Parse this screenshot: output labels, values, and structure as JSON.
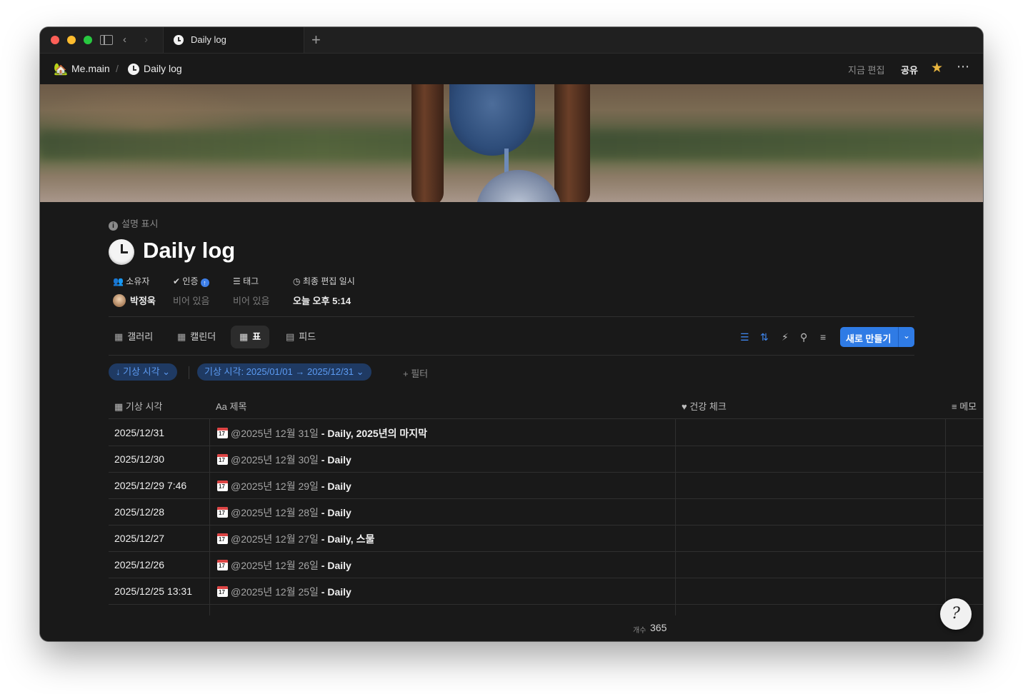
{
  "browser": {
    "tab_title": "Daily log",
    "new_tab_symbol": "+"
  },
  "breadcrumb": {
    "workspace": "Me.main",
    "separator": "/",
    "page": "Daily log"
  },
  "header_actions": {
    "edited": "지금 편집",
    "share": "공유"
  },
  "page": {
    "description_toggle": "설명 표시",
    "title": "Daily log"
  },
  "properties": [
    {
      "label": "소유자",
      "value": "박정욱",
      "empty": false
    },
    {
      "label": "인증",
      "value": "비어 있음",
      "empty": true
    },
    {
      "label": "태그",
      "value": "비어 있음",
      "empty": true
    },
    {
      "label": "최종 편집 일시",
      "value": "오늘 오후 5:14",
      "empty": false
    }
  ],
  "views": [
    {
      "label": "갤러리",
      "icon": "gallery-icon"
    },
    {
      "label": "캘린더",
      "icon": "calendar-icon"
    },
    {
      "label": "표",
      "icon": "table-icon",
      "active": true
    },
    {
      "label": "피드",
      "icon": "feed-icon"
    }
  ],
  "new_button": "새로 만들기",
  "filters": {
    "sort_chip": "↓ 기상 시각 ⌄",
    "range_chip": "기상 시각: 2025/01/01 → 2025/12/31 ⌄",
    "add_filter": "+ 필터"
  },
  "table": {
    "headers": [
      "기상 시각",
      "제목",
      "건강 체크",
      "메모"
    ],
    "rows": [
      {
        "date": "2025/12/31",
        "mention": "@2025년 12월 31일",
        "suffix": " - Daily, 2025년의 마지막"
      },
      {
        "date": "2025/12/30",
        "mention": "@2025년 12월 30일",
        "suffix": " - Daily"
      },
      {
        "date": "2025/12/29 7:46",
        "mention": "@2025년 12월 29일",
        "suffix": " - Daily"
      },
      {
        "date": "2025/12/28",
        "mention": "@2025년 12월 28일",
        "suffix": " - Daily"
      },
      {
        "date": "2025/12/27",
        "mention": "@2025년 12월 27일",
        "suffix": " - Daily, 스물"
      },
      {
        "date": "2025/12/26",
        "mention": "@2025년 12월 26일",
        "suffix": " - Daily"
      },
      {
        "date": "2025/12/25 13:31",
        "mention": "@2025년 12월 25일",
        "suffix": " - Daily"
      }
    ]
  },
  "footer": {
    "count_label": "개수",
    "count_value": "365"
  },
  "colors": {
    "accent": "#2f7be5",
    "star": "#e9b53e",
    "background": "#191919"
  }
}
